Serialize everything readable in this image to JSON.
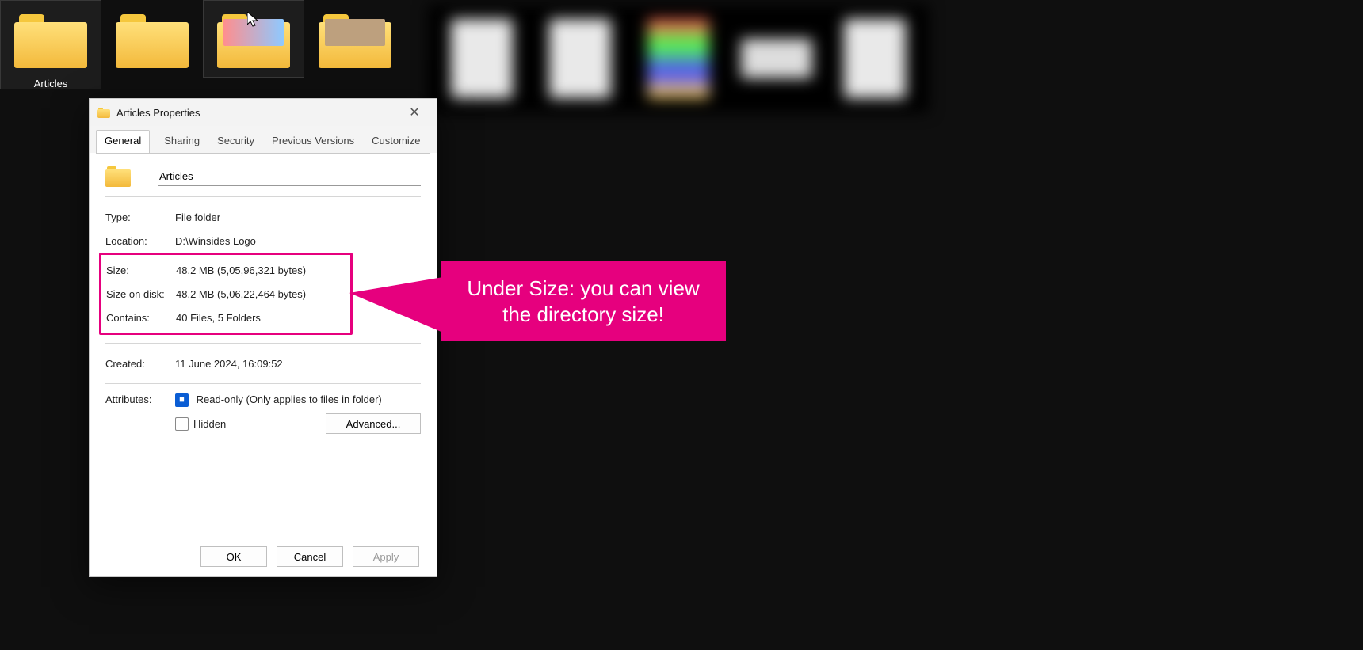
{
  "desktop": {
    "items": [
      {
        "label": "Articles",
        "kind": "folder"
      },
      {
        "label": "",
        "kind": "folder"
      },
      {
        "label": "",
        "kind": "folder_thumb1"
      },
      {
        "label": "",
        "kind": "folder_thumb2"
      }
    ]
  },
  "dialog": {
    "title": "Articles Properties",
    "tabs": [
      "General",
      "Sharing",
      "Security",
      "Previous Versions",
      "Customize"
    ],
    "active_tab": "General",
    "name_value": "Articles",
    "type": {
      "label": "Type:",
      "value": "File folder"
    },
    "location": {
      "label": "Location:",
      "value": "D:\\Winsides Logo"
    },
    "size": {
      "label": "Size:",
      "value": "48.2 MB (5,05,96,321 bytes)"
    },
    "size_on_disk": {
      "label": "Size on disk:",
      "value": "48.2 MB (5,06,22,464 bytes)"
    },
    "contains": {
      "label": "Contains:",
      "value": "40 Files, 5 Folders"
    },
    "created": {
      "label": "Created:",
      "value": "11 June 2024, 16:09:52"
    },
    "attributes_label": "Attributes:",
    "readonly_label": "Read-only (Only applies to files in folder)",
    "hidden_label": "Hidden",
    "advanced_label": "Advanced...",
    "buttons": {
      "ok": "OK",
      "cancel": "Cancel",
      "apply": "Apply"
    }
  },
  "callout": {
    "text": "Under Size: you can view the directory size!"
  },
  "colors": {
    "accent": "#e6007e",
    "win_blue": "#0a5dd4",
    "folder_yellow": "#f5c73d"
  }
}
